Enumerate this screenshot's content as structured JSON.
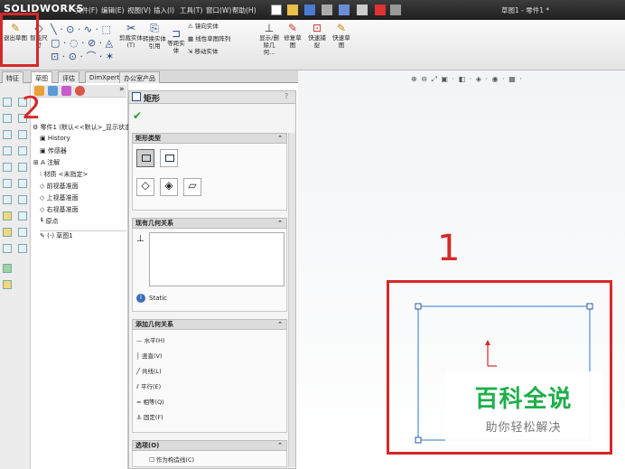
{
  "app": {
    "logo": "SOLIDWORKS",
    "menus": [
      "文件(F)",
      "编辑(E)",
      "视图(V)",
      "插入(I)",
      "工具(T)",
      "窗口(W)",
      "帮助(H)"
    ],
    "document_title": "草图1 - 零件1 *"
  },
  "toolbar": {
    "exit_sketch": "退出草图",
    "smart_dimension": "智能尺寸",
    "trim": "剪裁实体(T)",
    "convert": "转换实体引用",
    "offset": "等距实体",
    "mirror": "镜向实体",
    "linear_pattern": "线性草图阵列",
    "move": "移动实体",
    "show_delete": "显示/删除几何...",
    "repair": "修复草图",
    "quick_snap": "快速捕捉",
    "rapid_sketch": "快速草图"
  },
  "tabs": [
    "特征",
    "草图",
    "评估",
    "DimXpert",
    "办公室产品"
  ],
  "active_tab": "草图",
  "tree": {
    "root": "零件1 (默认<<默认>_显示状态",
    "items": [
      "History",
      "传感器",
      "注解",
      "材质 <未指定>",
      "前视基准面",
      "上视基准面",
      "右视基准面",
      "原点",
      "(-) 草图1"
    ]
  },
  "property_manager": {
    "title": "矩形",
    "help": "?",
    "sections": {
      "type": {
        "label": "矩形类型"
      },
      "existing": {
        "label": "现有几何关系",
        "status": "Static"
      },
      "add": {
        "label": "添加几何关系",
        "relations": [
          "水平(H)",
          "竖直(V)",
          "共线(L)",
          "平行(E)",
          "相等(Q)",
          "固定(F)"
        ]
      },
      "options": {
        "label": "选项(O)",
        "construction": "作为构造线(C)"
      }
    }
  },
  "graphics": {
    "view_icons": "⊕ ⊖ ⤢ ▣ · ◧ · ◈ · ◉ · ▦ ·"
  },
  "annotations": {
    "step1": "1",
    "step2": "2"
  },
  "watermark": {
    "title": "百科全说",
    "subtitle": "助你轻松解决"
  },
  "colors": {
    "annotation_red": "#d62828",
    "sketch_blue": "#4a90d9",
    "watermark_green": "#1fae4a"
  }
}
